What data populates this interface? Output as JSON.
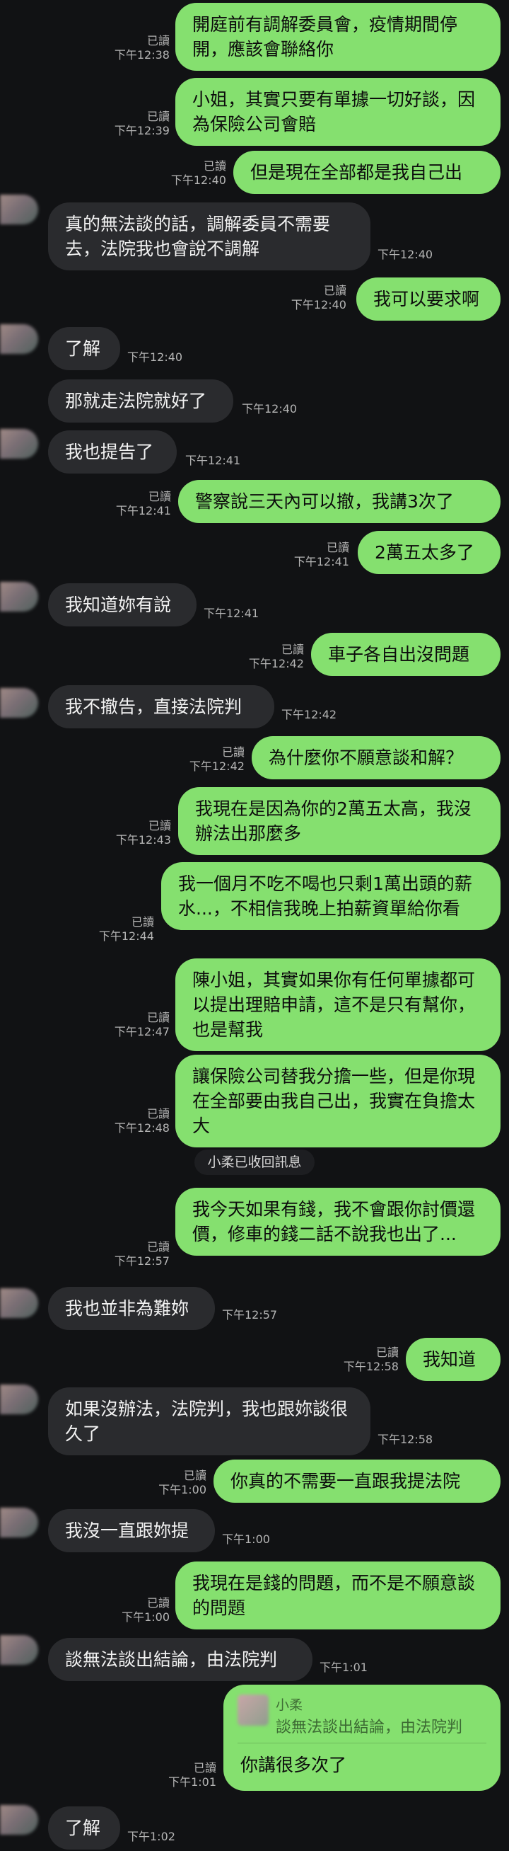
{
  "read_label": "已讀",
  "messages": [
    {
      "dir": "sent",
      "text": "開庭前有調解委員會，疫情期間停開，應該會聯絡你",
      "time": "下午12:38",
      "read": true
    },
    {
      "dir": "sent",
      "text": "小姐，其實只要有單據一切好談，因為保險公司會賠",
      "time": "下午12:39",
      "read": true
    },
    {
      "dir": "sent",
      "text": "但是現在全部都是我自己出",
      "time": "下午12:40",
      "read": true
    },
    {
      "dir": "recv",
      "text": "真的無法談的話，調解委員不需要去，法院我也會說不調解",
      "time": "下午12:40",
      "avatar": true
    },
    {
      "dir": "sent",
      "text": "我可以要求啊",
      "time": "下午12:40",
      "read": true
    },
    {
      "dir": "recv",
      "text": "了解",
      "time": "下午12:40",
      "avatar": true
    },
    {
      "dir": "recv",
      "text": "那就走法院就好了",
      "time": "下午12:40",
      "avatar": false
    },
    {
      "dir": "recv",
      "text": "我也提告了",
      "time": "下午12:41",
      "avatar": true
    },
    {
      "dir": "sent",
      "text": "警察說三天內可以撤，我講3次了",
      "time": "下午12:41",
      "read": true
    },
    {
      "dir": "sent",
      "text": "2萬五太多了",
      "time": "下午12:41",
      "read": true
    },
    {
      "dir": "recv",
      "text": "我知道妳有說",
      "time": "下午12:41",
      "avatar": true
    },
    {
      "dir": "sent",
      "text": "車子各自出沒問題",
      "time": "下午12:42",
      "read": true
    },
    {
      "dir": "recv",
      "text": "我不撤告，直接法院判",
      "time": "下午12:42",
      "avatar": true
    },
    {
      "dir": "sent",
      "text": "為什麼你不願意談和解？",
      "time": "下午12:42",
      "read": true
    },
    {
      "dir": "sent",
      "text": "我現在是因為你的2萬五太高，我沒辦法出那麼多",
      "time": "下午12:43",
      "read": true
    },
    {
      "dir": "sent",
      "text": "我一個月不吃不喝也只剩1萬出頭的薪水...，不相信我晚上拍薪資單給你看",
      "time": "下午12:44",
      "read": true
    },
    {
      "dir": "sent",
      "text": "陳小姐，其實如果你有任何單據都可以提出理賠申請，這不是只有幫你，也是幫我",
      "time": "下午12:47",
      "read": true
    },
    {
      "dir": "sent",
      "text": "讓保險公司替我分擔一些，但是你現在全部要由我自己出，我實在負擔太大",
      "time": "下午12:48",
      "read": true
    },
    {
      "dir": "sent",
      "text": "我今天如果有錢，我不會跟你討價還價，修車的錢二話不說我也出了...",
      "time": "下午12:57",
      "read": true
    },
    {
      "dir": "recv",
      "text": "我也並非為難妳",
      "time": "下午12:57",
      "avatar": true
    },
    {
      "dir": "sent",
      "text": "我知道",
      "time": "下午12:58",
      "read": true
    },
    {
      "dir": "recv",
      "text": "如果沒辦法，法院判，我也跟妳談很久了",
      "time": "下午12:58",
      "avatar": true
    },
    {
      "dir": "sent",
      "text": "你真的不需要一直跟我提法院",
      "time": "下午1:00",
      "read": true
    },
    {
      "dir": "recv",
      "text": "我沒一直跟妳提",
      "time": "下午1:00",
      "avatar": true
    },
    {
      "dir": "sent",
      "text": "我現在是錢的問題，而不是不願意談的問題",
      "time": "下午1:00",
      "read": true
    },
    {
      "dir": "recv",
      "text": "談無法談出結論，由法院判",
      "time": "下午1:01",
      "avatar": true
    },
    {
      "dir": "recv",
      "text": "了解",
      "time": "下午1:02",
      "avatar": true
    }
  ],
  "system_notice": "小柔已收回訊息",
  "quote_reply": {
    "quoted_name": "小柔",
    "quoted_text": "談無法談出結論，由法院判",
    "reply_text": "你講很多次了",
    "time": "下午1:01",
    "read": true
  }
}
